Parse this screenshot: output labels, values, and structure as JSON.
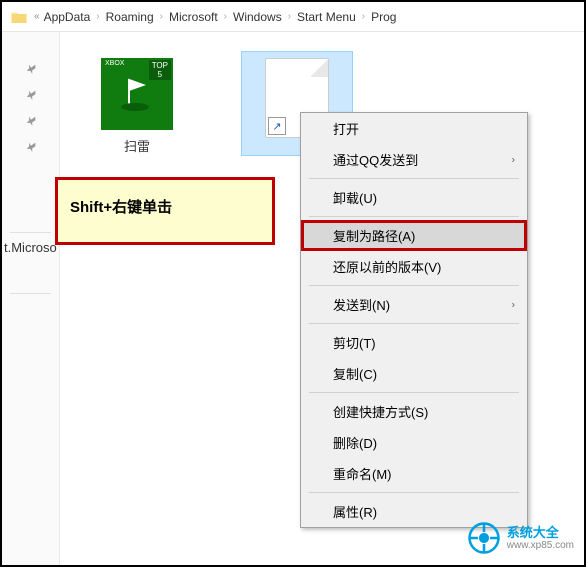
{
  "breadcrumb": {
    "items": [
      "AppData",
      "Roaming",
      "Microsoft",
      "Windows",
      "Start Menu",
      "Prog"
    ]
  },
  "sidebar": {
    "truncated_label": "t.Microso"
  },
  "files": {
    "item1_label": "扫雷",
    "item1_badge_xbox": "XBOX",
    "item1_badge_top": "TOP",
    "item1_badge_num": "5"
  },
  "callout": {
    "text": "Shift+右键单击"
  },
  "context_menu": {
    "open": "打开",
    "qq_send": "通过QQ发送到",
    "uninstall": "卸载(U)",
    "copy_path": "复制为路径(A)",
    "restore": "还原以前的版本(V)",
    "send_to": "发送到(N)",
    "cut": "剪切(T)",
    "copy": "复制(C)",
    "create_shortcut": "创建快捷方式(S)",
    "delete": "删除(D)",
    "rename": "重命名(M)",
    "properties": "属性(R)"
  },
  "watermark": {
    "title": "系统大全",
    "url": "www.xp85.com"
  }
}
